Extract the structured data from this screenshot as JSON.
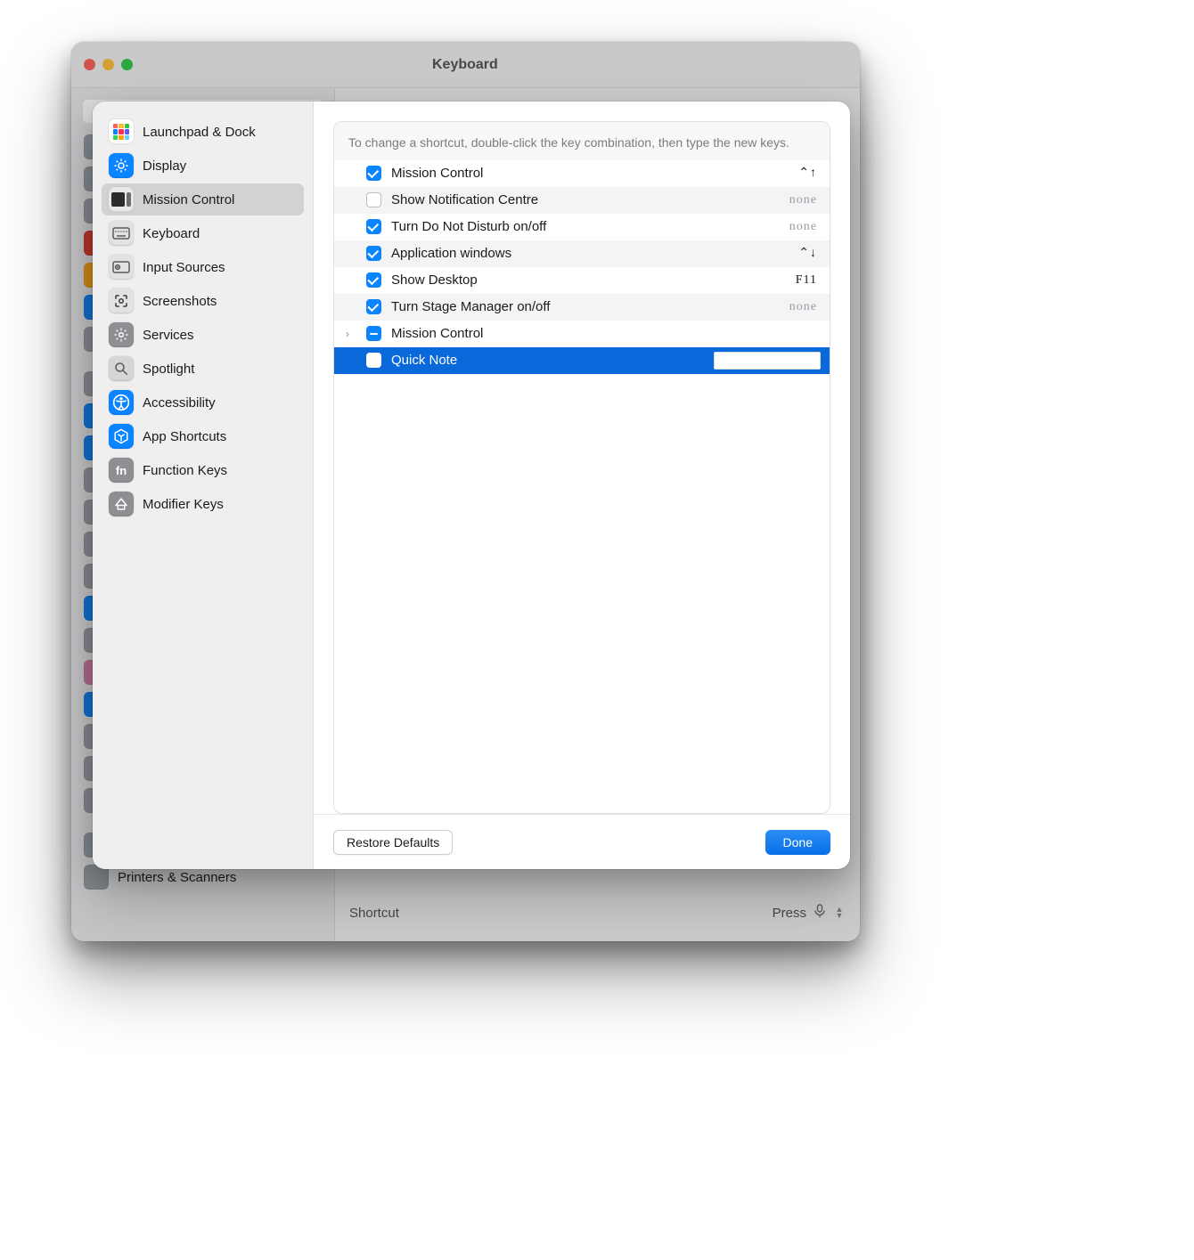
{
  "window": {
    "title": "Keyboard",
    "back_sidebar_item": "Printers & Scanners",
    "shortcut_label": "Shortcut",
    "press_label": "Press"
  },
  "sheet": {
    "categories": [
      {
        "id": "launchpad",
        "label": "Launchpad & Dock"
      },
      {
        "id": "display",
        "label": "Display"
      },
      {
        "id": "mission",
        "label": "Mission Control"
      },
      {
        "id": "keyboard",
        "label": "Keyboard"
      },
      {
        "id": "input",
        "label": "Input Sources"
      },
      {
        "id": "screenshots",
        "label": "Screenshots"
      },
      {
        "id": "services",
        "label": "Services"
      },
      {
        "id": "spotlight",
        "label": "Spotlight"
      },
      {
        "id": "accessibility",
        "label": "Accessibility"
      },
      {
        "id": "apps",
        "label": "App Shortcuts"
      },
      {
        "id": "function",
        "label": "Function Keys"
      },
      {
        "id": "modifier",
        "label": "Modifier Keys"
      }
    ],
    "selected_category": "mission",
    "hint": "To change a shortcut, double-click the key combination, then type the new keys.",
    "shortcuts": [
      {
        "enabled": true,
        "label": "Mission Control",
        "shortcut": "⌃↑",
        "sc_class": ""
      },
      {
        "enabled": false,
        "label": "Show Notification Centre",
        "shortcut": "none",
        "sc_class": "none"
      },
      {
        "enabled": true,
        "label": "Turn Do Not Disturb on/off",
        "shortcut": "none",
        "sc_class": "none"
      },
      {
        "enabled": true,
        "label": "Application windows",
        "shortcut": "⌃↓",
        "sc_class": ""
      },
      {
        "enabled": true,
        "label": "Show Desktop",
        "shortcut": "F11",
        "sc_class": ""
      },
      {
        "enabled": true,
        "label": "Turn Stage Manager on/off",
        "shortcut": "none",
        "sc_class": "none"
      },
      {
        "enabled": "mixed",
        "label": "Mission Control",
        "shortcut": "",
        "sc_class": "",
        "disclosure": true
      },
      {
        "enabled": false,
        "label": "Quick Note",
        "shortcut": "",
        "sc_class": "",
        "selected": true,
        "editing": true
      }
    ],
    "restore_label": "Restore Defaults",
    "done_label": "Done"
  }
}
